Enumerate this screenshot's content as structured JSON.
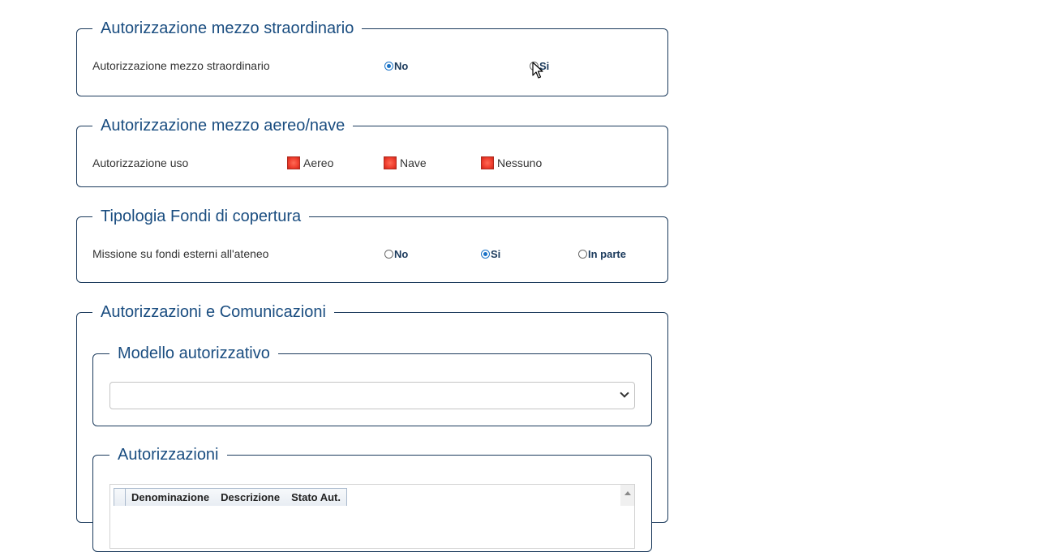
{
  "straordinario": {
    "legend": "Autorizzazione mezzo straordinario",
    "row_label": "Autorizzazione mezzo straordinario",
    "options": [
      {
        "label": "No",
        "checked": true
      },
      {
        "label": "Si",
        "checked": false
      }
    ]
  },
  "aereo_nave": {
    "legend": "Autorizzazione mezzo aereo/nave",
    "row_label": "Autorizzazione uso",
    "options": [
      "Aereo",
      "Nave",
      "Nessuno"
    ]
  },
  "fondi": {
    "legend": "Tipologia Fondi di copertura",
    "row_label": "Missione su fondi esterni all'ateneo",
    "options": [
      {
        "label": "No",
        "checked": false
      },
      {
        "label": "Si",
        "checked": true
      },
      {
        "label": "In parte",
        "checked": false
      }
    ]
  },
  "autorizzazioni_comunicazioni": {
    "legend": "Autorizzazioni e Comunicazioni",
    "modello": {
      "legend": "Modello autorizzativo",
      "selected_value": ""
    },
    "autorizzazioni": {
      "legend": "Autorizzazioni",
      "columns": [
        "Denominazione",
        "Descrizione",
        "Stato Aut."
      ]
    }
  },
  "colors": {
    "legend_text": "#1a4d80",
    "border": "#1b3a5c",
    "radio_checked": "#1a73c7",
    "checkbox_fill": "#ef3e2e"
  }
}
